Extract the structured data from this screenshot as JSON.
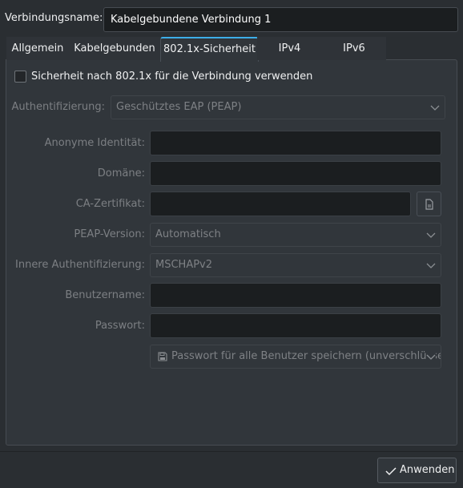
{
  "header": {
    "connection_name_label": "Verbindungsname:",
    "connection_name_value": "Kabelgebundene Verbindung 1"
  },
  "tabs": [
    {
      "label": "Allgemein"
    },
    {
      "label": "Kabelgebunden"
    },
    {
      "label": "802.1x-Sicherheit"
    },
    {
      "label": "IPv4"
    },
    {
      "label": "IPv6"
    }
  ],
  "active_tab": "802.1x-Sicherheit",
  "security": {
    "use_8021x_label": "Sicherheit nach 802.1x für die Verbindung verwenden",
    "use_8021x_checked": false,
    "auth_label": "Authentifizierung:",
    "auth_value": "Geschütztes EAP (PEAP)",
    "anon_identity_label": "Anonyme Identität:",
    "anon_identity_value": "",
    "domain_label": "Domäne:",
    "domain_value": "",
    "ca_cert_label": "CA-Zertifikat:",
    "ca_cert_value": "",
    "ca_cert_button_icon": "file-open-icon",
    "peap_version_label": "PEAP-Version:",
    "peap_version_value": "Automatisch",
    "inner_auth_label": "Innere Authentifizierung:",
    "inner_auth_value": "MSCHAPv2",
    "username_label": "Benutzername:",
    "username_value": "",
    "password_label": "Passwort:",
    "password_value": "",
    "password_store_value": "Passwort für alle Benutzer speichern (unverschlüsselt)",
    "password_store_icon": "save-icon"
  },
  "footer": {
    "apply_label": "Anwenden",
    "apply_icon": "checkmark-icon"
  },
  "colors": {
    "window_bg": "#2a2e32",
    "panel_bg": "#31363b",
    "field_bg": "#1b1e20",
    "accent": "#3daee9",
    "text": "#fcfcfc",
    "text_disabled": "#7c7f83"
  }
}
